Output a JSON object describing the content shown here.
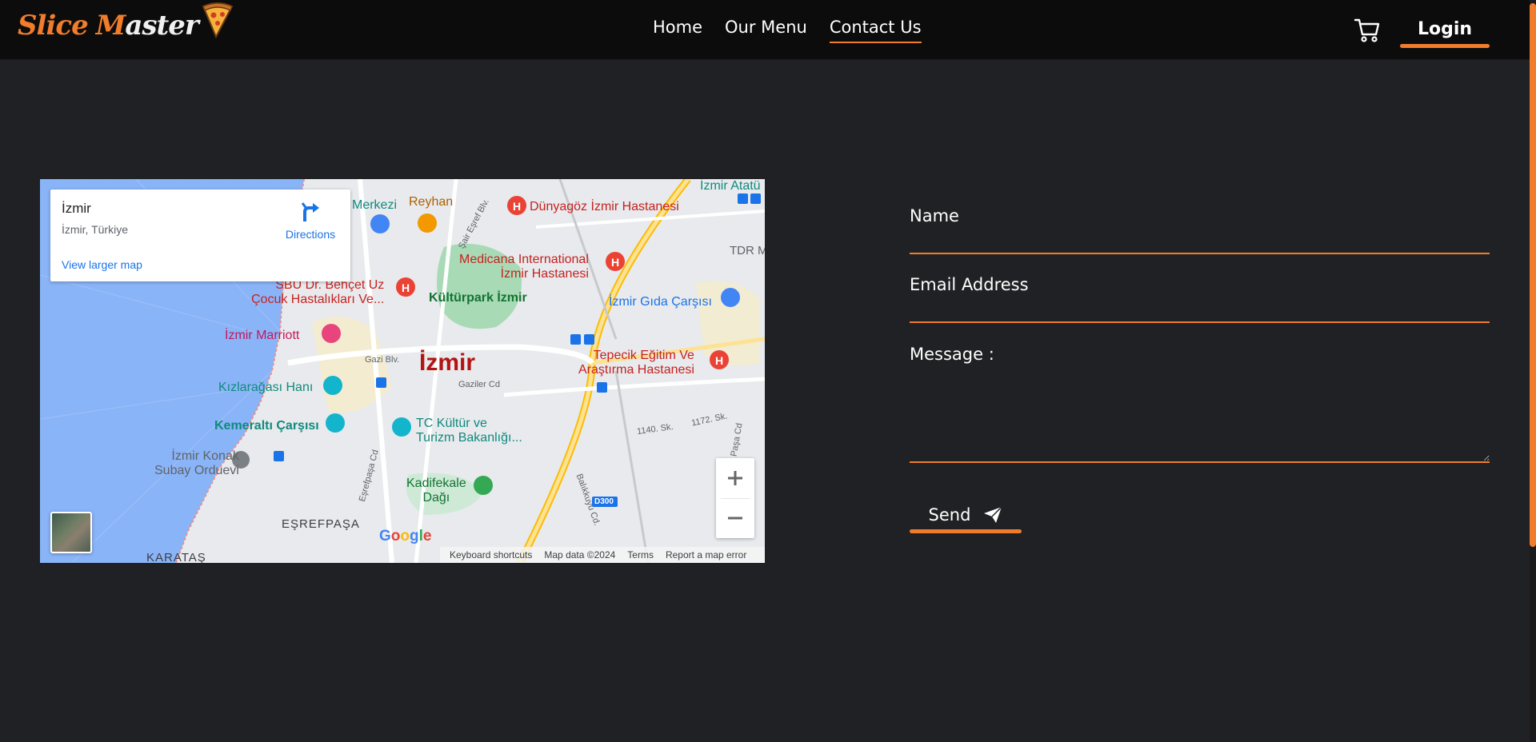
{
  "brand": {
    "word1": "Slice",
    "word2_cap": "M",
    "word2_rest": "aster",
    "accent": "#f07c2c"
  },
  "nav": {
    "links": [
      {
        "label": "Home",
        "active": false
      },
      {
        "label": "Our Menu",
        "active": false
      },
      {
        "label": "Contact Us",
        "active": true
      }
    ],
    "cart_icon": "shopping-cart-icon",
    "login_label": "Login"
  },
  "map": {
    "card": {
      "title": "İzmir",
      "subtitle": "İzmir, Türkiye",
      "directions_label": "Directions",
      "view_larger": "View larger map"
    },
    "labels": {
      "city": "İzmir",
      "dunyagoz": "Dünyagöz İzmir Hastanesi",
      "reyhan": "Reyhan",
      "merkezi": "Merkezi",
      "medicana": "Medicana International",
      "medicana2": "İzmir Hastanesi",
      "sbu": "SBÜ Dr. Behçet Uz",
      "sbu2": "Çocuk Hastalıkları Ve...",
      "kulturpark": "Kültürpark İzmir",
      "gida": "İzmir Gıda Çarşısı",
      "marriott": "İzmir Marriott",
      "tepecik": "Tepecik Eğitim Ve",
      "tepecik2": "Araştırma Hastanesi",
      "kizlaragasi": "Kızlarağası Hanı",
      "kemeralti": "Kemeraltı Çarşısı",
      "tc": "TC Kültür ve",
      "tc2": "Turizm Bakanlığı...",
      "konak": "İzmir Konak",
      "konak2": "Subay Orduevi",
      "kadifekale": "Kadifekale",
      "kadifekale2": "Dağı",
      "esrefpasa": "EŞREFPAŞA",
      "karatas": "KARATAŞ",
      "ataturk": "İzmir Atatü",
      "tdr": "TDR M",
      "gazi": "Gazi Blv.",
      "gaziler": "Gaziler Cd",
      "sair": "Şair Eşref Blv.",
      "esrefpasa_cd": "Eşrefpaşa Cd",
      "balikuyu": "Balıkkuyu Cd.",
      "sk1140": "1140. Sk.",
      "sk1172": "1172. Sk.",
      "pasa": "Paşa Cd",
      "d300": "D300"
    },
    "google": "Google",
    "footer": [
      "Keyboard shortcuts",
      "Map data ©2024",
      "Terms",
      "Report a map error"
    ]
  },
  "form": {
    "name_label": "Name",
    "email_label": "Email Address",
    "message_label": "Message :",
    "name_value": "",
    "email_value": "",
    "message_value": "",
    "send_label": "Send",
    "send_icon": "paper-plane-icon"
  }
}
